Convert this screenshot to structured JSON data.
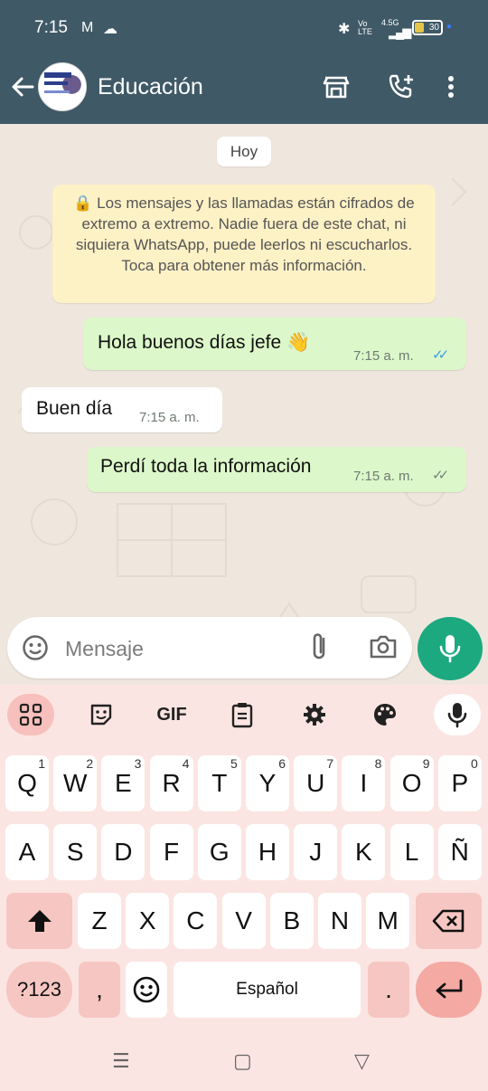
{
  "status_bar": {
    "time": "7:15",
    "icons": [
      "gmail-icon",
      "cloud-icon",
      "bluetooth-icon",
      "volte-icon",
      "signal-icon",
      "battery-icon"
    ],
    "volte_text": "Vo LTE",
    "network_text": "4.5G",
    "battery_text": "30"
  },
  "app_bar": {
    "title": "Educación",
    "icons": [
      "back-arrow-icon",
      "group-avatar",
      "store-icon",
      "add-call-icon",
      "more-vert-icon"
    ]
  },
  "chat": {
    "day_chip": "Hoy",
    "encryption_notice": "🔒 Los mensajes y las llamadas están cifrados de extremo a extremo. Nadie fuera de este chat, ni siquiera WhatsApp, puede leerlos ni escucharlos. Toca para obtener más información.",
    "messages": [
      {
        "direction": "out",
        "text": "Hola buenos días jefe 👋",
        "time": "7:15 a. m.",
        "status": "read"
      },
      {
        "direction": "in",
        "text": "Buen día",
        "time": "7:15 a. m."
      },
      {
        "direction": "out",
        "text": "Perdí toda la información",
        "time": "7:15 a. m.",
        "status": "delivered"
      }
    ]
  },
  "compose": {
    "placeholder": "Mensaje",
    "icons": [
      "emoji-icon",
      "attach-icon",
      "camera-icon",
      "mic-icon"
    ]
  },
  "keyboard": {
    "toolbar": [
      "apps-grid-icon",
      "sticker-icon",
      "GIF",
      "clipboard-icon",
      "settings-icon",
      "palette-icon",
      "mic-icon"
    ],
    "gif_label": "GIF",
    "row1": [
      {
        "k": "Q",
        "n": "1"
      },
      {
        "k": "W",
        "n": "2"
      },
      {
        "k": "E",
        "n": "3"
      },
      {
        "k": "R",
        "n": "4"
      },
      {
        "k": "T",
        "n": "5"
      },
      {
        "k": "Y",
        "n": "6"
      },
      {
        "k": "U",
        "n": "7"
      },
      {
        "k": "I",
        "n": "8"
      },
      {
        "k": "O",
        "n": "9"
      },
      {
        "k": "P",
        "n": "0"
      }
    ],
    "row2": [
      "A",
      "S",
      "D",
      "F",
      "G",
      "H",
      "J",
      "K",
      "L",
      "Ñ"
    ],
    "row3": [
      "Z",
      "X",
      "C",
      "V",
      "B",
      "N",
      "M"
    ],
    "symbols_key": "?123",
    "comma_key": ",",
    "space_label": "Español",
    "period_key": ".",
    "accent_color": "#1ca980"
  },
  "nav_bar": [
    "recents-icon",
    "home-icon",
    "back-icon"
  ]
}
